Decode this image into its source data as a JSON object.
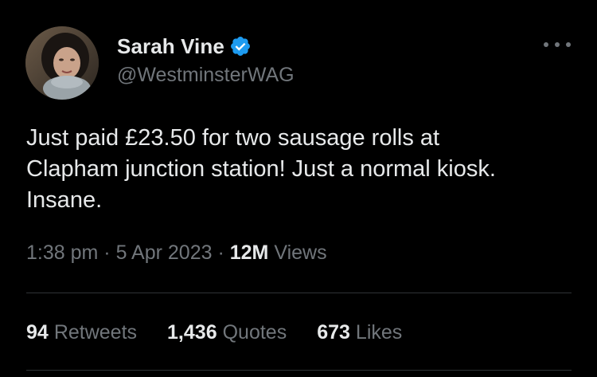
{
  "author": {
    "display_name": "Sarah Vine",
    "handle": "@WestminsterWAG",
    "verified": true,
    "avatar_icon": "profile-photo"
  },
  "tweet": {
    "text_lines": [
      "Just paid £23.50 for two sausage rolls at",
      "Clapham junction station! Just a normal kiosk.",
      "Insane."
    ],
    "time": "1:38 pm",
    "separator": "·",
    "date": "5 Apr 2023",
    "views_count": "12M",
    "views_label": "Views"
  },
  "stats": {
    "retweets_count": "94",
    "retweets_label": "Retweets",
    "quotes_count": "1,436",
    "quotes_label": "Quotes",
    "likes_count": "673",
    "likes_label": "Likes"
  },
  "colors": {
    "background": "#000000",
    "primary_text": "#e7e9ea",
    "secondary_text": "#71767b",
    "verified_blue": "#1d9bf0",
    "divider": "#2f3336"
  },
  "icons": {
    "verified": "verified-badge-icon",
    "more": "more-horizontal-icon"
  }
}
